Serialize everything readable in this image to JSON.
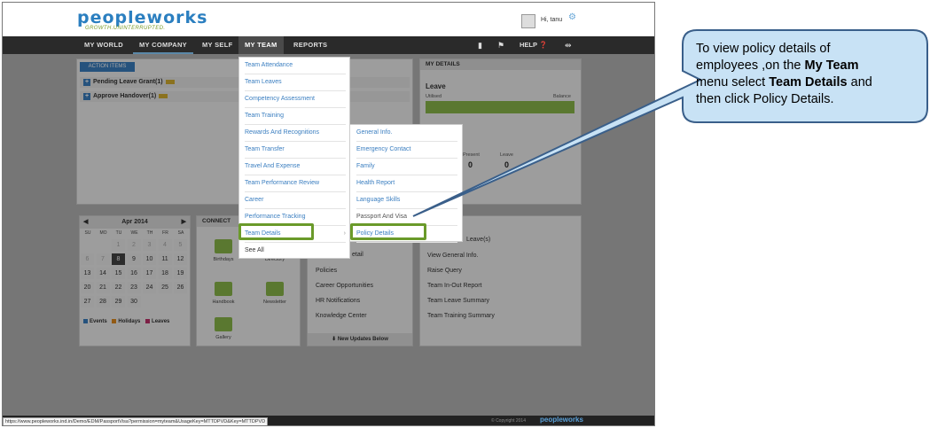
{
  "header": {
    "logo_main": "peopleworks",
    "tagline": "GROWTH.UNINTERRUPTED.",
    "greeting": "Hi, tanu"
  },
  "nav": {
    "items": [
      "MY WORLD",
      "MY COMPANY",
      "MY SELF",
      "MY TEAM",
      "REPORTS"
    ],
    "help": "HELP"
  },
  "action": {
    "tab": "ACTION ITEMS",
    "rows": [
      "Pending Leave Grant(1)",
      "Approve Handover(1)"
    ]
  },
  "details": {
    "title": "MY DETAILS",
    "leave_title": "Leave",
    "utilised": "Utilised",
    "balance": "Balance",
    "attendance_title": "ce",
    "att_labels": [
      "Present",
      "Leave"
    ],
    "att_values": [
      "0",
      "0"
    ]
  },
  "calendar": {
    "month": "Apr 2014",
    "dow": [
      "SU",
      "MO",
      "TU",
      "WE",
      "TH",
      "FR",
      "SA"
    ],
    "days": [
      [
        "",
        "",
        "1",
        "2",
        "3",
        "4",
        "5"
      ],
      [
        "6",
        "7",
        "8",
        "9",
        "10",
        "11",
        "12"
      ],
      [
        "13",
        "14",
        "15",
        "16",
        "17",
        "18",
        "19"
      ],
      [
        "20",
        "21",
        "22",
        "23",
        "24",
        "25",
        "26"
      ],
      [
        "27",
        "28",
        "29",
        "30",
        "",
        "",
        ""
      ]
    ],
    "legend": [
      "Events",
      "Holidays",
      "Leaves"
    ]
  },
  "connect": {
    "title": "CONNECT",
    "tiles": [
      "Birthdays",
      "Directory",
      "Handbook",
      "Newsletter",
      "Gallery"
    ]
  },
  "updates": {
    "items": [
      "etail",
      "Policies",
      "Career Opportunities",
      "HR Notifications",
      "Knowledge Center"
    ],
    "footer": "New Updates Below"
  },
  "links": {
    "items": [
      "Leave(s)",
      "View General Info.",
      "Raise Query",
      "Team In-Out Report",
      "Team Leave Summary",
      "Team Training Summary"
    ]
  },
  "menu_team": {
    "items": [
      "Team Attendance",
      "Team Leaves",
      "Competency Assessment",
      "Team Training",
      "Rewards And Recognitions",
      "Team Transfer",
      "Travel And Expense",
      "Team Performance Review",
      "Career",
      "Performance Tracking",
      "Team Details",
      "See All"
    ]
  },
  "menu_details": {
    "items": [
      "General Info.",
      "Emergency Contact",
      "Family",
      "Health Report",
      "Language Skills",
      "Passport And Visa",
      "Policy Details"
    ]
  },
  "footer": {
    "url": "https://www.peopleworks.ind.in/Demo/EDM/PassportVisa?permission=myteam&UsageKey=MTTDPVD&Key=MTTDPVD",
    "copyright": "© Copyright 2014",
    "logo": "peopleworks"
  },
  "callout": {
    "line1": "To view  policy details of",
    "line2_pre": "employees ,on the ",
    "line2_bold": "My Team",
    "line3_pre": "menu select ",
    "line3_bold": "Team Details",
    "line3_post": " and",
    "line4": "then click Policy Details."
  },
  "colors": {
    "accent_blue": "#3a7ec0",
    "highlight_green": "#6a9a2a",
    "callout_fill": "#c8e2f5",
    "callout_border": "#3a5f8a"
  }
}
